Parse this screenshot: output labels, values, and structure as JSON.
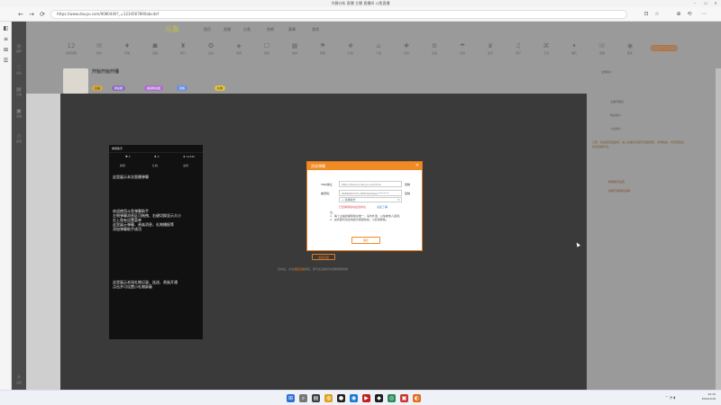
{
  "window": {
    "title": "冷静分析 直播 主播 直播间 斗鱼直播",
    "min": "–",
    "max": "☐",
    "close": "✕"
  },
  "browser": {
    "back": "←",
    "forward": "→",
    "reload": "⟳",
    "url": "https://www.douyu.com/9080440?_=1234567890abcdef",
    "tools": [
      "⊡",
      "☆",
      "⊕",
      "⟲",
      "⋯"
    ],
    "sidebar": [
      "◧",
      "≡",
      "⊞",
      "☰"
    ]
  },
  "site": {
    "logo": "斗鱼",
    "nav_side": [
      {
        "icon": "◎",
        "label": "推荐"
      },
      {
        "icon": "♡",
        "label": "关注"
      },
      {
        "icon": "▤",
        "label": "分类"
      },
      {
        "icon": "▣",
        "label": "直播"
      },
      {
        "icon": "◇",
        "label": "鱼吧"
      },
      {
        "icon": "☼",
        "label": "设置"
      }
    ],
    "top_menu": [
      "首页",
      "直播",
      "分类",
      "鱼吧",
      "赛事",
      "游戏"
    ],
    "top_icons": [
      {
        "icon": "12",
        "label": "免费领取"
      },
      {
        "icon": "✉",
        "label": "我的"
      },
      {
        "icon": "♦",
        "label": "开播"
      },
      {
        "icon": "☗",
        "label": "直播"
      },
      {
        "icon": "♜",
        "label": "排行"
      },
      {
        "icon": "✪",
        "label": "活动"
      },
      {
        "icon": "◈",
        "label": "游戏"
      },
      {
        "icon": "☐",
        "label": "视频"
      },
      {
        "icon": "▦",
        "label": "鱼吧"
      },
      {
        "icon": "⚑",
        "label": "赛事"
      },
      {
        "icon": "❖",
        "label": "礼物"
      },
      {
        "icon": "⌂",
        "label": "下载"
      },
      {
        "icon": "✚",
        "label": "任务"
      },
      {
        "icon": "⚙",
        "label": "设置"
      },
      {
        "icon": "☂",
        "label": "充值"
      },
      {
        "icon": "♛",
        "label": "会员"
      },
      {
        "icon": "♫",
        "label": "音乐"
      },
      {
        "icon": "⌘",
        "label": "工具"
      },
      {
        "icon": "✦",
        "label": "福利"
      },
      {
        "icon": "☏",
        "label": "客服"
      },
      {
        "icon": "◉",
        "label": "更多"
      }
    ],
    "login_label": "开播设置",
    "room_title": "开始开始开播",
    "tags": [
      "主播",
      "粉丝团",
      "超级粉丝团",
      "贵族",
      "礼物"
    ]
  },
  "chat_widget": {
    "title": "弹幕助手",
    "stats": [
      "♥ 3",
      "♣ 2",
      "♠ 12345"
    ],
    "tabs": [
      "弹幕",
      "礼物",
      "进场"
    ],
    "messages": [
      "这里展示本次直播弹幕",
      "欢迎使用斗鱼弹幕助手\n左侧弹幕消息区可拖拽、右键切换显示大小\n右上角有设置菜单\n这里展示弹幕、贵族消息、礼物播报等\n添加弹幕助手成功",
      "这里展示本场礼物记录、连送、贵族开通\n点击并可设置小礼物屏蔽"
    ]
  },
  "dialog": {
    "title": "添加弹幕",
    "close": "×",
    "rows": [
      {
        "label": "http地址：",
        "value": "http://danmu.douyu.com/live",
        "side": "复制"
      },
      {
        "label": "推流码：",
        "value": "9080440?d=c95f7a0c6aec********",
        "side": "复制"
      }
    ],
    "select_value": "+ 选择模式",
    "warning": "已经弹幕模块加载成功",
    "learn_more": "点此了解",
    "notes": "注：\n1、每个主播的弹幕地址唯一，请勿外泄，以免被他人盗用；\n2、如有疑问请咨询官方客服热线，以获得帮助。",
    "confirm": "确定"
  },
  "overlay": {
    "button": "发起直播",
    "note_prefix": "完成后，点击",
    "note_highlight": "发起直播",
    "note_suffix": "按钮，即可在直播间中观看弹幕效果"
  },
  "right_panel": {
    "header": "全部用户",
    "users": [
      "主播管理员",
      "粉丝用户",
      "斗鱼用户"
    ],
    "notice": "公告：欢迎来到直播间，进入直播间请遵守直播规范，文明发言，共同营造良好的直播环境。",
    "links": [
      "弹幕助手设置",
      "贵族开通特权说明"
    ]
  },
  "taskbar": {
    "apps": [
      {
        "icon": "⊞",
        "color": "#2f6fd6"
      },
      {
        "icon": "⌕",
        "color": "#777"
      },
      {
        "icon": "▤",
        "color": "#3d3d3d"
      },
      {
        "icon": "◍",
        "color": "#e0a020"
      },
      {
        "icon": "●",
        "color": "#222"
      },
      {
        "icon": "◉",
        "color": "#1a7ad8"
      },
      {
        "icon": "▶",
        "color": "#c02020"
      },
      {
        "icon": "◆",
        "color": "#1c1c1c"
      },
      {
        "icon": "◎",
        "color": "#2a8a5a"
      },
      {
        "icon": "▣",
        "color": "#cc3333"
      },
      {
        "icon": "◐",
        "color": "#e86a1a"
      }
    ],
    "tray": "⌃ ◔ ◖",
    "time": "10:15",
    "date": "2024/1/16"
  }
}
